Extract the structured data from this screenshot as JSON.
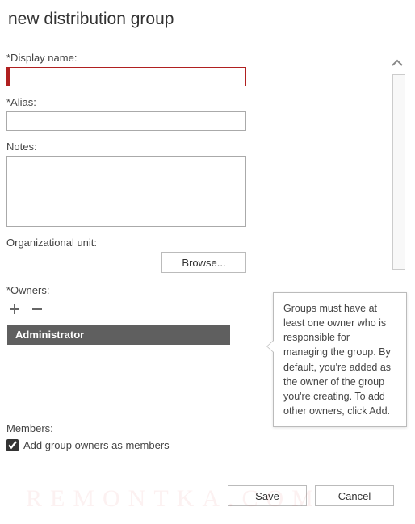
{
  "title": "new distribution group",
  "labels": {
    "display_name": "*Display name:",
    "alias": "*Alias:",
    "notes": "Notes:",
    "ou": "Organizational unit:",
    "owners": "*Owners:",
    "members": "Members:"
  },
  "fields": {
    "display_name": "",
    "alias": "",
    "notes": "",
    "ou": ""
  },
  "browse_label": "Browse...",
  "owners_list": [
    "Administrator"
  ],
  "members_checkbox": {
    "checked": true,
    "label": "Add group owners as members"
  },
  "tooltip_text": "Groups must have at least one owner who is responsible for managing the group. By default, you're added as the owner of the group you're creating. To add other owners, click Add.",
  "buttons": {
    "save": "Save",
    "cancel": "Cancel"
  },
  "watermark": "REMONTKA.COM"
}
